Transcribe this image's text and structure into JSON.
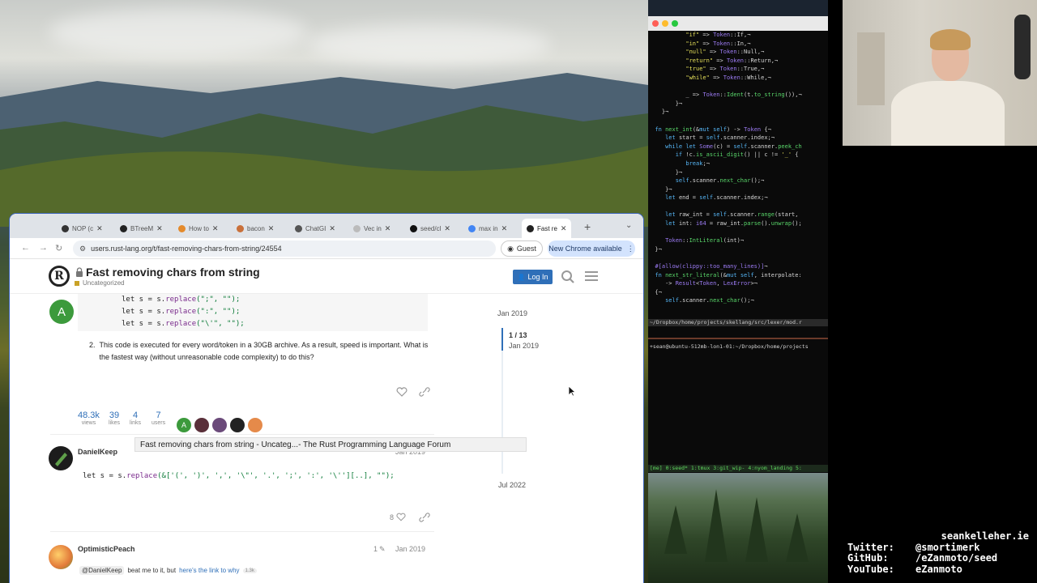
{
  "browser": {
    "tabs": [
      {
        "label": "NOP (c"
      },
      {
        "label": "BTreeM"
      },
      {
        "label": "How to"
      },
      {
        "label": "bacon"
      },
      {
        "label": "ChatGI"
      },
      {
        "label": "Vec in"
      },
      {
        "label": "seed/cl"
      },
      {
        "label": "max in"
      },
      {
        "label": "Fast re"
      }
    ],
    "url": "users.rust-lang.org/t/fast-removing-chars-from-string/24554",
    "guest_label": "Guest",
    "new_chrome_label": "New Chrome available"
  },
  "forum": {
    "logo_letter": "R",
    "title": "Fast removing chars from string",
    "category": "Uncategorized",
    "login_label": "Log In",
    "code_lines": [
      {
        "a": "let s = s.",
        "f": "replace",
        "b": "(\";\", \"\");"
      },
      {
        "a": "let s = s.",
        "f": "replace",
        "b": "(\":\", \"\");"
      },
      {
        "a": "let s = s.",
        "f": "replace",
        "b": "(\"\\'\", \"\");"
      }
    ],
    "paragraph_num": "2.",
    "paragraph": "This code is executed for every word/token in a 30GB archive. As a result, speed is important. What is the fastest way (without unreasonable code complexity) to do this?",
    "post1_avatar_letter": "A",
    "stats": [
      {
        "n": "48.3k",
        "l": "views"
      },
      {
        "n": "39",
        "l": "likes"
      },
      {
        "n": "4",
        "l": "links"
      },
      {
        "n": "7",
        "l": "users"
      }
    ],
    "participants_avatar_letter": "A",
    "tooltip": "Fast removing chars from string - Uncateg...- The Rust Programming Language Forum",
    "reply1": {
      "author": "DanielKeep",
      "date": "Jan 2019",
      "code_a": "let s = s.",
      "code_f": "replace",
      "code_b": "(&['(', ')', ',', '\\\"', '.', ';', ':', '\\''][..], \"\");",
      "likes": "8"
    },
    "reply2": {
      "author": "OptimisticPeach",
      "edits": "1",
      "date": "Jan 2019",
      "mention": "@DanielKeep",
      "text": "beat me to it, but",
      "link": "here's the link to why",
      "clicks": "1.3k"
    },
    "timeline": {
      "top_date": "Jan 2019",
      "position": "1 / 13",
      "position_date": "Jan 2019",
      "bottom_date": "Jul 2022"
    }
  },
  "terminal": {
    "lines": [
      {
        "ln": "",
        "html": "           <span class='str2'>\"if\"</span> => <span class='ty'>Token</span>::If,¬"
      },
      {
        "ln": "",
        "html": "           <span class='str2'>\"in\"</span> => <span class='ty'>Token</span>::In,¬"
      },
      {
        "ln": "",
        "html": "           <span class='str2'>\"null\"</span> => <span class='ty'>Token</span>::Null,¬"
      },
      {
        "ln": "",
        "html": "           <span class='str2'>\"return\"</span> => <span class='ty'>Token</span>::Return,¬"
      },
      {
        "ln": "",
        "html": "           <span class='str2'>\"true\"</span> => <span class='ty'>Token</span>::True,¬"
      },
      {
        "ln": "",
        "html": "           <span class='str2'>\"while\"</span> => <span class='ty'>Token</span>::While,¬"
      },
      {
        "ln": "",
        "html": ""
      },
      {
        "ln": "",
        "html": "           _ => <span class='ty'>Token</span>::<span class='fnc'>Ident</span>(t.<span class='fnc'>to_string</span>()),¬"
      },
      {
        "ln": "",
        "html": "        }¬"
      },
      {
        "ln": "",
        "html": "    }¬"
      },
      {
        "ln": "",
        "html": ""
      },
      {
        "ln": "",
        "html": "  <span class='kw'>fn</span> <span class='fnc'>next_int</span>(&<span class='kw'>mut</span> <span class='kw'>self</span>) -> <span class='ty'>Token</span> {¬"
      },
      {
        "ln": "",
        "html": "     <span class='kw'>let</span> start = <span class='kw'>self</span>.scanner.index;¬"
      },
      {
        "ln": "",
        "html": "     <span class='kw'>while</span> <span class='kw'>let</span> <span class='ty'>Some</span>(c) = <span class='kw'>self</span>.scanner.<span class='fnc'>peek_ch</span>"
      },
      {
        "ln": "",
        "html": "        <span class='kw'>if</span> !c.<span class='fnc'>is_ascii_digit</span>() || c != <span class='str2'>'_'</span> {"
      },
      {
        "ln": "",
        "html": "           <span class='kw'>break</span>;¬"
      },
      {
        "ln": "",
        "html": "        }¬"
      },
      {
        "ln": "",
        "html": "        <span class='kw'>self</span>.scanner.<span class='fnc'>next_char</span>();¬"
      },
      {
        "ln": "",
        "html": "     }¬"
      },
      {
        "ln": "",
        "html": "     <span class='kw'>let</span> end = <span class='kw'>self</span>.scanner.index;¬"
      },
      {
        "ln": "",
        "html": ""
      },
      {
        "ln": "",
        "html": "     <span class='kw'>let</span> raw_int = <span class='kw'>self</span>.scanner.<span class='fnc'>range</span>(start,"
      },
      {
        "ln": "",
        "html": "     <span class='kw'>let</span> int: <span class='ty'>i64</span> = raw_int.<span class='fnc'>parse</span>().<span class='fnc'>unwrap</span>();"
      },
      {
        "ln": "",
        "html": ""
      },
      {
        "ln": "",
        "html": "     <span class='ty'>Token</span>::<span class='fnc'>IntLiteral</span>(int)¬"
      },
      {
        "ln": "",
        "html": "  }¬"
      },
      {
        "ln": "",
        "html": ""
      },
      {
        "ln": "",
        "html": "  <span class='cm'>#[allow(clippy::too_many_lines)]</span>¬"
      },
      {
        "ln": "",
        "html": "  <span class='kw'>fn</span> <span class='fnc'>next_str_literal</span>(&<span class='kw'>mut</span> <span class='kw'>self</span>, interpolate:"
      },
      {
        "ln": "",
        "html": "     -> <span class='ty'>Result</span>&lt;<span class='ty'>Token</span>, <span class='ty'>LexError</span>&gt;¬"
      },
      {
        "ln": "",
        "html": "  {¬"
      },
      {
        "ln": "",
        "html": "     <span class='kw'>self</span>.scanner.<span class='fnc'>next_char</span>();¬"
      }
    ],
    "status1": "~/Dropbox/home/projects/skellang/src/lexer/mod.r",
    "prompt": "+sean@ubuntu-512mb-lon1-01:~/Dropbox/home/projects",
    "status2": "[me] 0:seed* 1:tmux  3:git_wip- 4:nyom_landing  5:"
  },
  "overlay": {
    "domain": "seankelleher.ie",
    "rows": [
      {
        "k": "Twitter:",
        "v": "@smortimerk"
      },
      {
        "k": "GitHub:",
        "v": "/eZanmoto/seed"
      },
      {
        "k": "YouTube:",
        "v": "eZanmoto"
      }
    ]
  }
}
